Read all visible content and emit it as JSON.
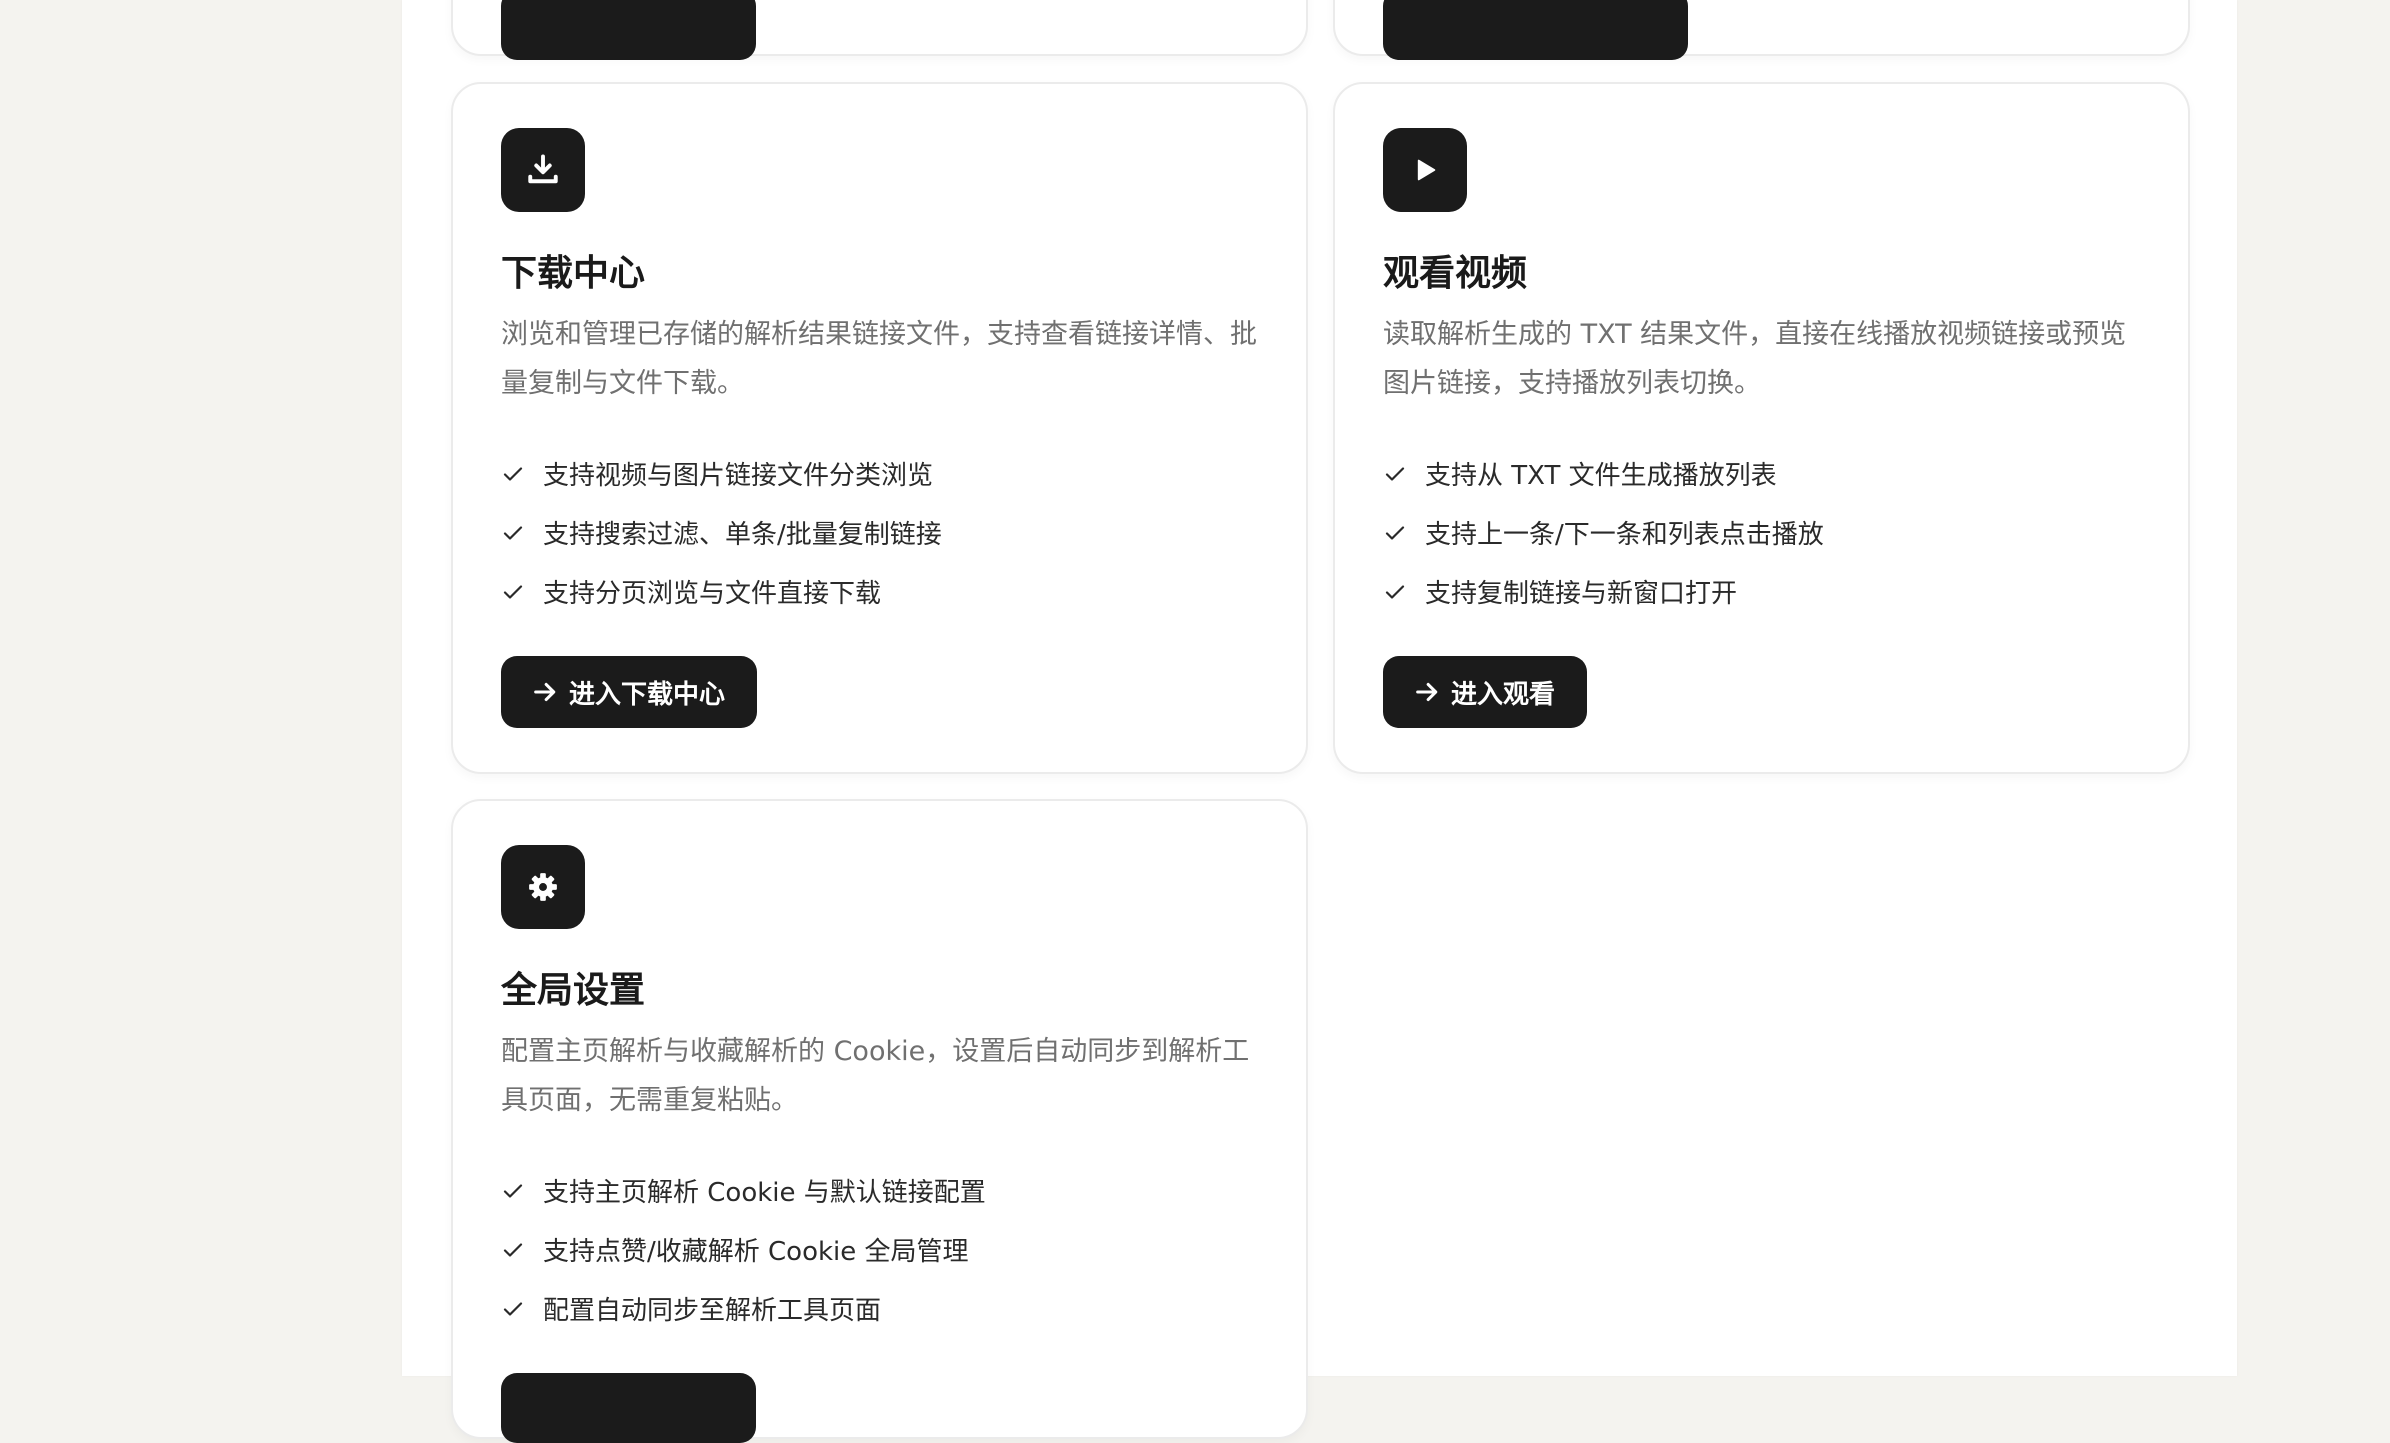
{
  "cards": [
    {
      "id": "download",
      "icon": "download-icon",
      "title": "下载中心",
      "description": "浏览和管理已存储的解析结果链接文件，支持查看链接详情、批量复制与文件下载。",
      "features": [
        "支持视频与图片链接文件分类浏览",
        "支持搜索过滤、单条/批量复制链接",
        "支持分页浏览与文件直接下载"
      ],
      "button_label": "进入下载中心"
    },
    {
      "id": "watch",
      "icon": "play-icon",
      "title": "观看视频",
      "description": "读取解析生成的 TXT 结果文件，直接在线播放视频链接或预览图片链接，支持播放列表切换。",
      "features": [
        "支持从 TXT 文件生成播放列表",
        "支持上一条/下一条和列表点击播放",
        "支持复制链接与新窗口打开"
      ],
      "button_label": "进入观看"
    },
    {
      "id": "settings",
      "icon": "gear-icon",
      "title": "全局设置",
      "description": "配置主页解析与收藏解析的 Cookie，设置后自动同步到解析工具页面，无需重复粘贴。",
      "features": [
        "支持主页解析 Cookie 与默认链接配置",
        "支持点赞/收藏解析 Cookie 全局管理",
        "配置自动同步至解析工具页面"
      ],
      "button_label": ""
    }
  ],
  "colors": {
    "page_background": "#f4f3ef",
    "panel_background": "#ffffff",
    "accent_dark": "#1b1b1b",
    "description_text": "#707070",
    "card_border": "#ebebeb"
  }
}
